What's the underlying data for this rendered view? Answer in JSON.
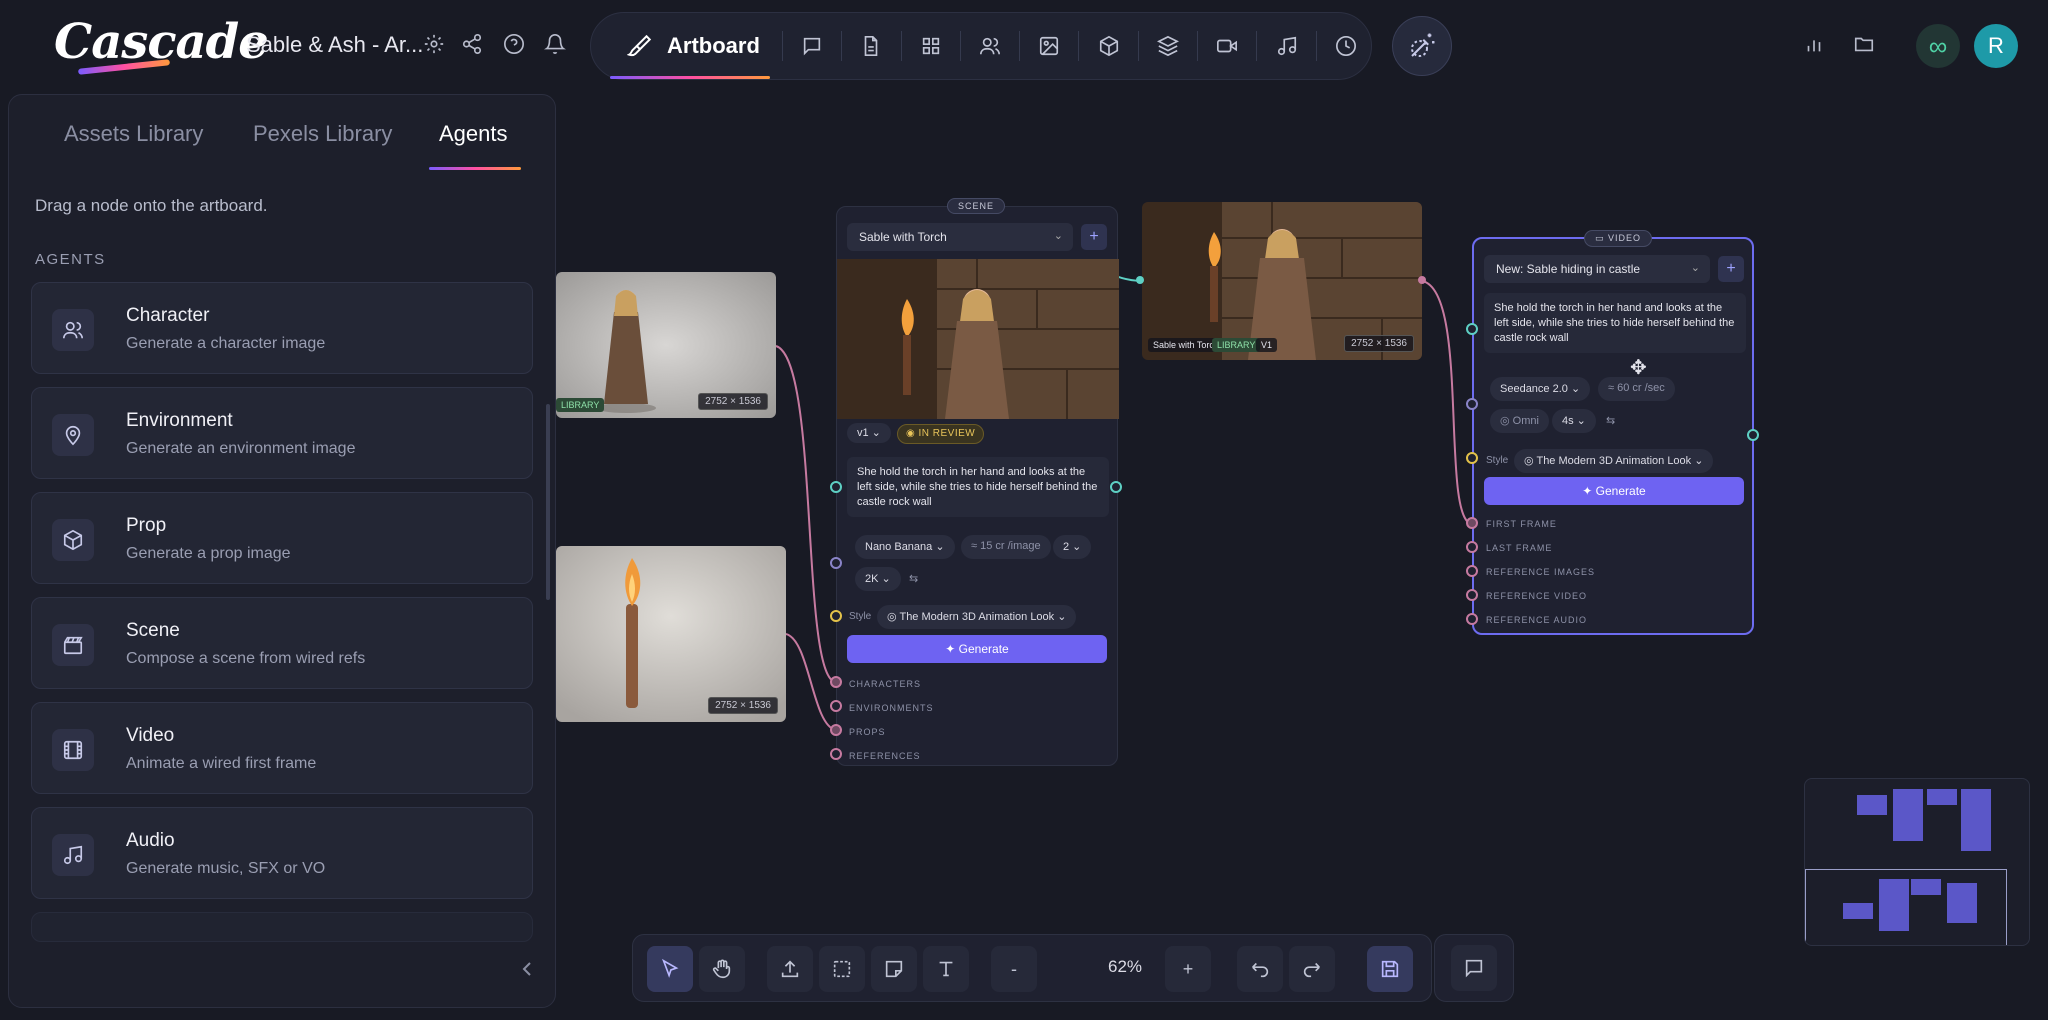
{
  "app": {
    "logo": "Cascade",
    "project_title": "Sable & Ash - Ar..."
  },
  "toolbar": {
    "artboard_label": "Artboard"
  },
  "avatar_initial": "R",
  "infinity_symbol": "∞",
  "panel": {
    "tabs": [
      "Assets Library",
      "Pexels Library",
      "Agents"
    ],
    "active_tab": "Agents",
    "hint": "Drag a node onto the artboard.",
    "section_label": "AGENTS",
    "agents": [
      {
        "title": "Character",
        "desc": "Generate a character image",
        "icon": "users-icon"
      },
      {
        "title": "Environment",
        "desc": "Generate an environment image",
        "icon": "map-pin-icon"
      },
      {
        "title": "Prop",
        "desc": "Generate a prop image",
        "icon": "cube-icon"
      },
      {
        "title": "Scene",
        "desc": "Compose a scene from wired refs",
        "icon": "clapperboard-icon"
      },
      {
        "title": "Video",
        "desc": "Animate a wired first frame",
        "icon": "film-icon"
      },
      {
        "title": "Audio",
        "desc": "Generate music, SFX or VO",
        "icon": "music-note-icon"
      }
    ]
  },
  "canvas": {
    "character_image": {
      "dims": "2752 × 1536",
      "tag": "LIBRARY"
    },
    "torch_image": {
      "dims": "2752 × 1536"
    },
    "scene_node": {
      "chip": "SCENE",
      "title": "Sable with Torch",
      "version": "v1",
      "status": "IN REVIEW",
      "prompt": "She hold the torch in her hand and looks at the left side, while she tries to hide herself behind the castle rock wall",
      "model": "Nano Banana",
      "cost": "≈ 15 cr /image",
      "count": "2",
      "resolution": "2K",
      "style_label": "Style",
      "style": "The Modern 3D Animation Look",
      "generate_label": "Generate",
      "ports": [
        "CHARACTERS",
        "ENVIRONMENTS",
        "PROPS",
        "REFERENCES"
      ]
    },
    "preview_image": {
      "caption": "Sable with Torch",
      "tag": "LIBRARY",
      "version": "V1",
      "dims": "2752 × 1536"
    },
    "video_node": {
      "chip": "VIDEO",
      "title": "New: Sable hiding in castle",
      "prompt": "She hold the torch in her hand and looks at the left side, while she tries to hide herself behind the castle rock wall",
      "model": "Seedance 2.0",
      "cost": "≈ 60 cr /sec",
      "aspect": "Omni",
      "duration": "4s",
      "style_label": "Style",
      "style": "The Modern 3D Animation Look",
      "generate_label": "Generate",
      "ports": [
        "FIRST FRAME",
        "LAST FRAME",
        "REFERENCE IMAGES",
        "REFERENCE VIDEO",
        "REFERENCE AUDIO"
      ]
    }
  },
  "bottom": {
    "zoom": "62%",
    "zoom_out": "-",
    "zoom_in": "+"
  }
}
